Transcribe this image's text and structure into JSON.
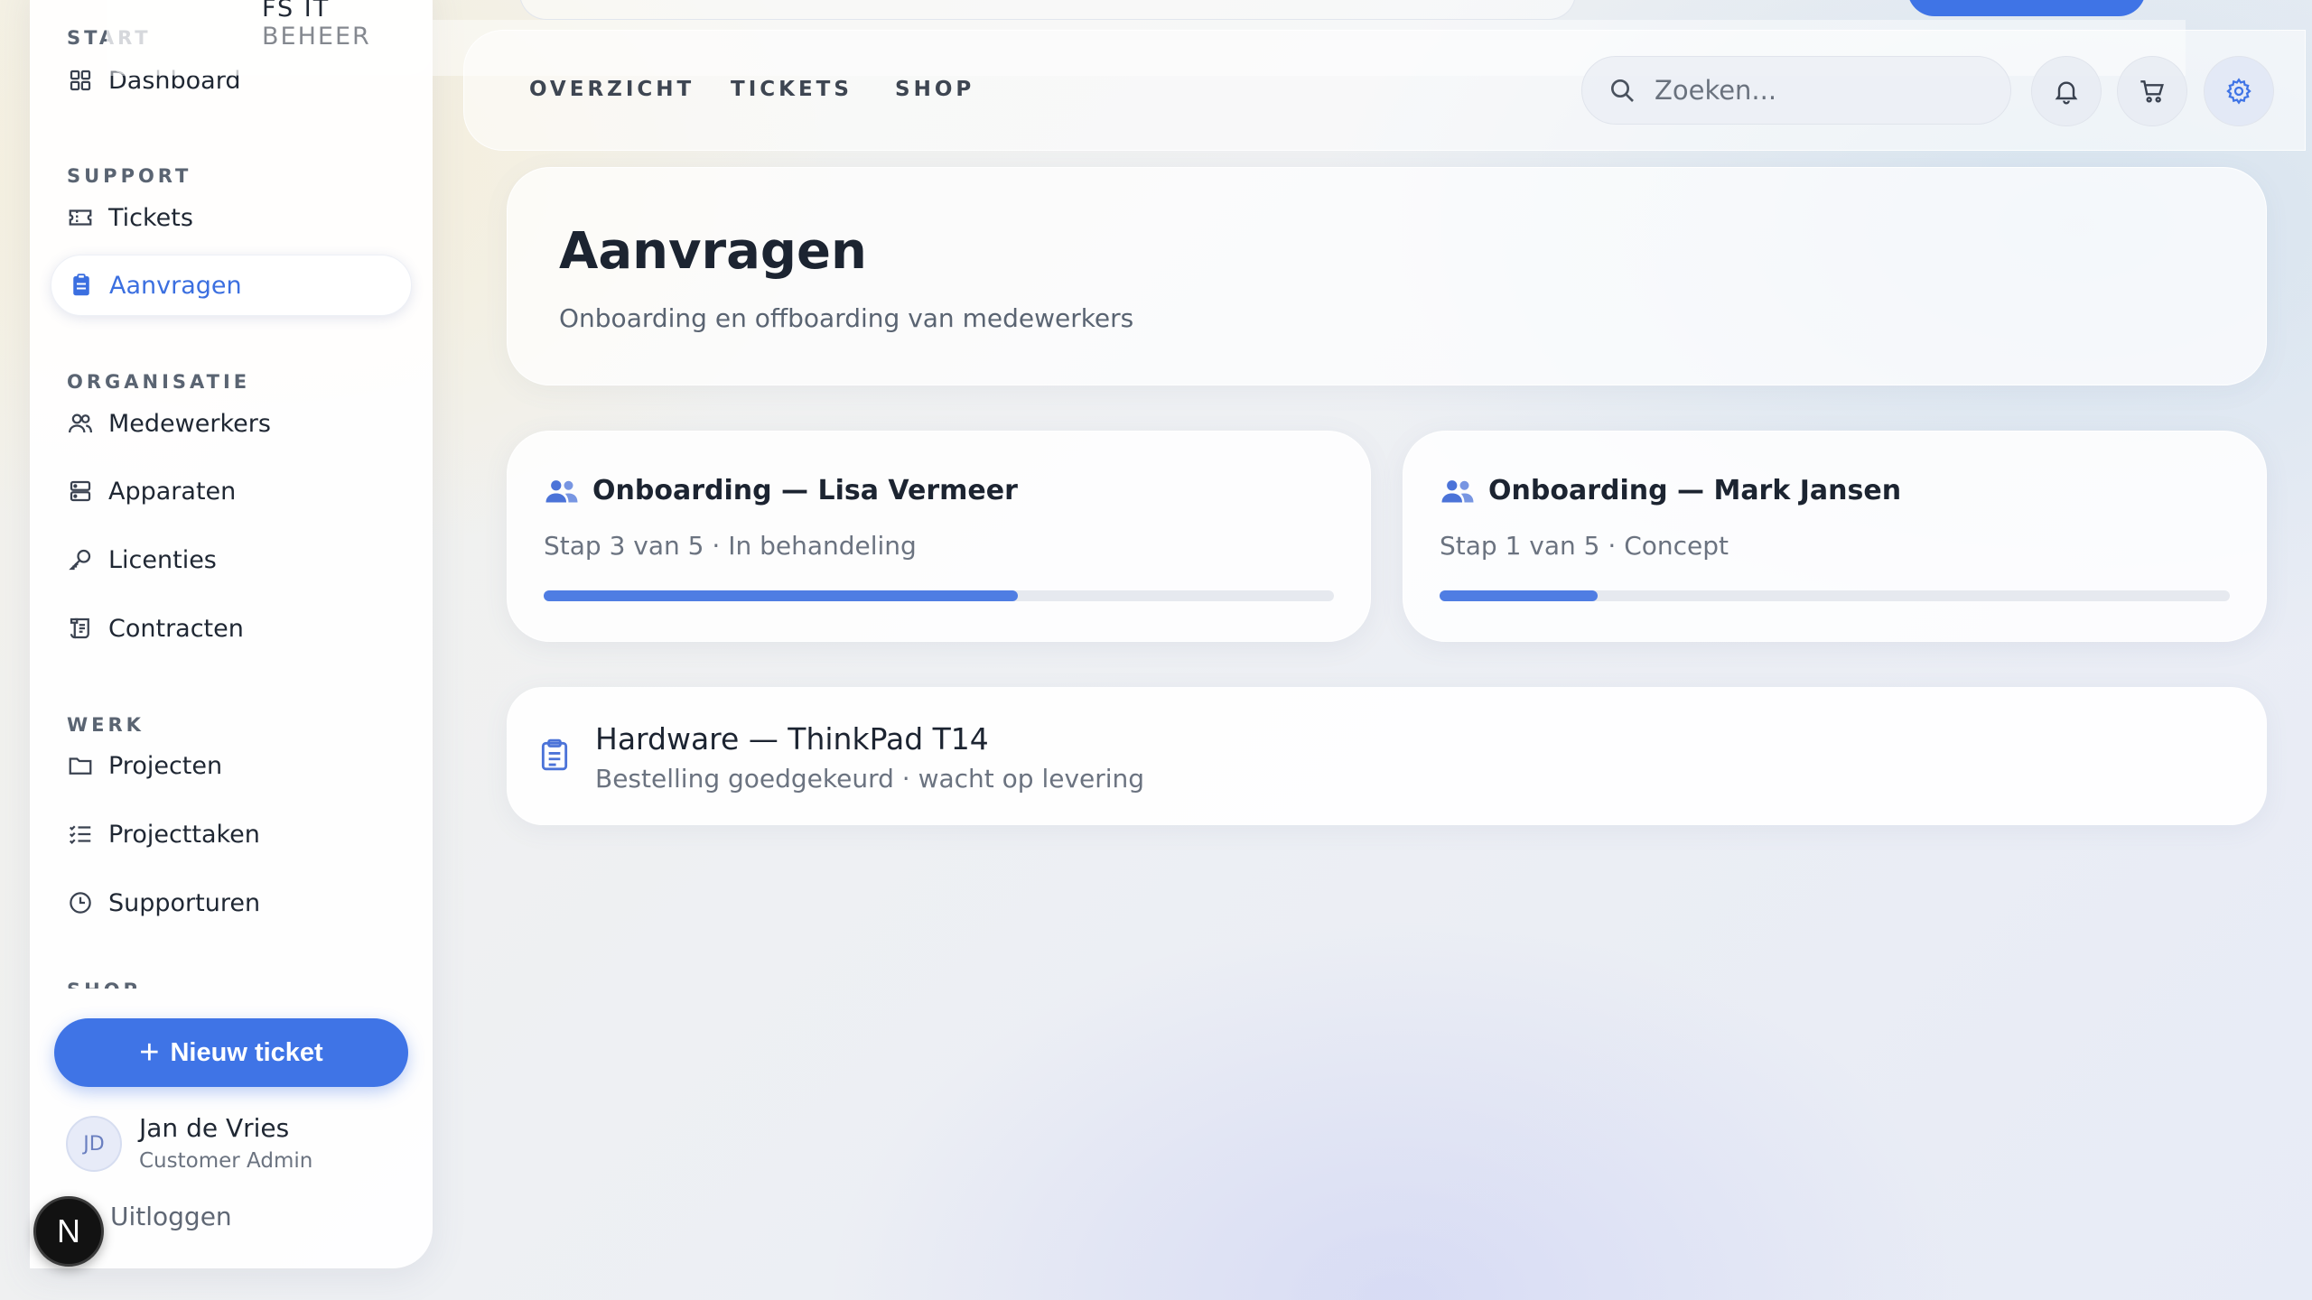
{
  "brand": {
    "name": "FS IT BEHEER"
  },
  "sidebar": {
    "sections": {
      "start": "START",
      "support": "SUPPORT",
      "organisatie": "ORGANISATIE",
      "werk": "WERK",
      "shop": "SHOP"
    },
    "items": {
      "dashboard": "Dashboard",
      "tickets": "Tickets",
      "aanvragen": "Aanvragen",
      "medewerkers": "Medewerkers",
      "apparaten": "Apparaten",
      "licenties": "Licenties",
      "contracten": "Contracten",
      "projecten": "Projecten",
      "projecttaken": "Projecttaken",
      "supporturen": "Supporturen"
    },
    "active_item": "Aanvragen",
    "new_ticket_label": "Nieuw ticket",
    "user": {
      "initials": "JD",
      "name": "Jan de Vries",
      "role": "Customer Admin"
    },
    "logout_label": "Uitloggen"
  },
  "header": {
    "tabs": [
      "OVERZICHT",
      "TICKETS",
      "SHOP"
    ],
    "search_placeholder": "Zoeken..."
  },
  "page": {
    "title": "Aanvragen",
    "subtitle": "Onboarding en offboarding van medewerkers"
  },
  "requests": {
    "onboarding": [
      {
        "title": "Onboarding — Lisa Vermeer",
        "status": "Stap 3 van 5 · In behandeling",
        "progress": 0.6
      },
      {
        "title": "Onboarding — Mark Jansen",
        "status": "Stap 1 van 5 · Concept",
        "progress": 0.2
      }
    ],
    "hardware": {
      "title": "Hardware — ThinkPad T14",
      "status": "Bestelling goedgekeurd · wacht op levering"
    }
  },
  "dev_badge": "N",
  "colors": {
    "accent": "#3f74e6",
    "text": "#1c2431",
    "muted": "#6b7380"
  }
}
